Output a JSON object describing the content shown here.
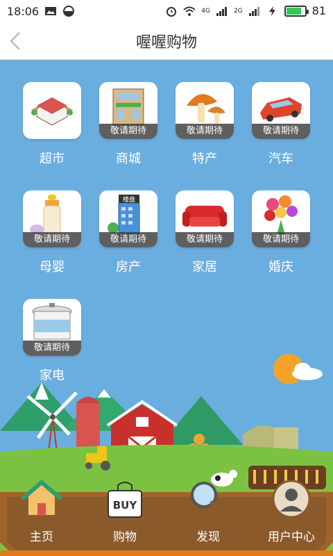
{
  "status_bar": {
    "time": "18:06",
    "battery_level": "81",
    "network_1": "4G",
    "network_2": "2G",
    "battery_fill_percent": 81,
    "battery_color": "#34c759"
  },
  "nav": {
    "title": "喔喔购物",
    "back_icon": "chevron-left-icon"
  },
  "categories": [
    {
      "label": "超市",
      "badge": "",
      "icon": "supermarket-icon"
    },
    {
      "label": "商城",
      "badge": "敬请期待",
      "icon": "mall-icon"
    },
    {
      "label": "特产",
      "badge": "敬请期待",
      "icon": "mushroom-icon"
    },
    {
      "label": "汽车",
      "badge": "敬请期待",
      "icon": "car-icon"
    },
    {
      "label": "母婴",
      "badge": "敬请期待",
      "icon": "baby-bottle-icon"
    },
    {
      "label": "房产",
      "badge": "敬请期待",
      "icon": "building-icon"
    },
    {
      "label": "家居",
      "badge": "敬请期待",
      "icon": "sofa-icon"
    },
    {
      "label": "婚庆",
      "badge": "敬请期待",
      "icon": "flowers-icon"
    },
    {
      "label": "家电",
      "badge": "敬请期待",
      "icon": "rice-cooker-icon"
    }
  ],
  "building_sign": "楼盘",
  "bottom_nav": {
    "items": [
      {
        "label": "主页",
        "icon": "house-icon"
      },
      {
        "label": "购物",
        "icon": "buy-bag-icon",
        "icon_text": "BUY"
      },
      {
        "label": "发现",
        "icon": "magnifier-icon"
      },
      {
        "label": "用户中心",
        "icon": "user-avatar-icon"
      }
    ]
  },
  "colors": {
    "sky": "#6aaee0",
    "grass": "#7cc242",
    "soil": "#8b5a2b",
    "white": "#ffffff"
  }
}
